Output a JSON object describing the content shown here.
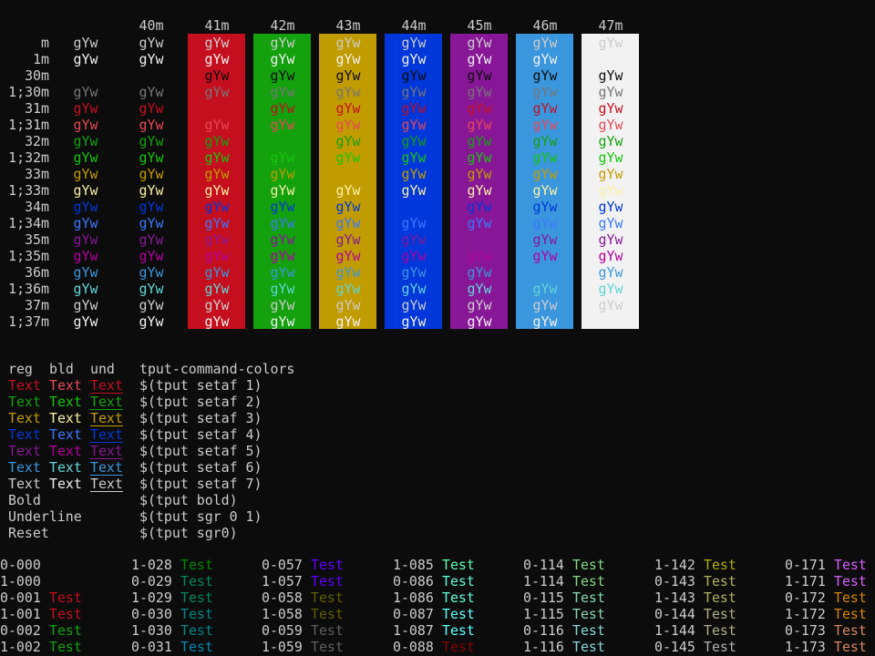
{
  "terminal": {
    "background": "#0C0C0C",
    "foreground": "#CCCCCC"
  },
  "color_table": {
    "sample_text": "gYw",
    "columns": [
      {
        "label": "",
        "bg": null
      },
      {
        "label": "40m",
        "bg": null
      },
      {
        "label": "41m",
        "bg": "#C50F1F"
      },
      {
        "label": "42m",
        "bg": "#13A10E"
      },
      {
        "label": "43m",
        "bg": "#C19C00"
      },
      {
        "label": "44m",
        "bg": "#0037DA"
      },
      {
        "label": "45m",
        "bg": "#881798"
      },
      {
        "label": "46m",
        "bg": "#3A96DD"
      },
      {
        "label": "47m",
        "bg": "#F2F2F2"
      }
    ],
    "rows": [
      {
        "label": "m",
        "fg": "#CCCCCC"
      },
      {
        "label": "1m",
        "fg": "#F2F2F2"
      },
      {
        "label": "30m",
        "fg": "#0C0C0C"
      },
      {
        "label": "1;30m",
        "fg": "#767676"
      },
      {
        "label": "31m",
        "fg": "#C50F1F"
      },
      {
        "label": "1;31m",
        "fg": "#E74856"
      },
      {
        "label": "32m",
        "fg": "#13A10E"
      },
      {
        "label": "1;32m",
        "fg": "#16C60C"
      },
      {
        "label": "33m",
        "fg": "#C19C00"
      },
      {
        "label": "1;33m",
        "fg": "#F9F1A5"
      },
      {
        "label": "34m",
        "fg": "#0037DA"
      },
      {
        "label": "1;34m",
        "fg": "#3B78FF"
      },
      {
        "label": "35m",
        "fg": "#881798"
      },
      {
        "label": "1;35m",
        "fg": "#B4009E"
      },
      {
        "label": "36m",
        "fg": "#3A96DD"
      },
      {
        "label": "1;36m",
        "fg": "#61D6D6"
      },
      {
        "label": "37m",
        "fg": "#CCCCCC"
      },
      {
        "label": "1;37m",
        "fg": "#F2F2F2"
      }
    ]
  },
  "tput": {
    "headers": [
      "reg",
      "bld",
      "und",
      "tput-command-colors"
    ],
    "sample_text": "Text",
    "color_rows": [
      {
        "reg": "#C50F1F",
        "bld": "#E74856",
        "cmd": "$(tput setaf 1)"
      },
      {
        "reg": "#13A10E",
        "bld": "#16C60C",
        "cmd": "$(tput setaf 2)"
      },
      {
        "reg": "#C19C00",
        "bld": "#F9F1A5",
        "cmd": "$(tput setaf 3)"
      },
      {
        "reg": "#0037DA",
        "bld": "#3B78FF",
        "cmd": "$(tput setaf 4)"
      },
      {
        "reg": "#881798",
        "bld": "#B4009E",
        "cmd": "$(tput setaf 5)"
      },
      {
        "reg": "#3A96DD",
        "bld": "#61D6D6",
        "cmd": "$(tput setaf 6)"
      },
      {
        "reg": "#CCCCCC",
        "bld": "#F2F2F2",
        "cmd": "$(tput setaf 7)"
      }
    ],
    "attr_rows": [
      {
        "label": "Bold",
        "cmd": "$(tput bold)"
      },
      {
        "label": "Underline",
        "cmd": "$(tput sgr 0 1)"
      },
      {
        "label": "Reset",
        "cmd": "$(tput sgr0)"
      }
    ]
  },
  "palette_256": {
    "sample_text": "Test",
    "columns": [
      [
        {
          "code": "0-000",
          "color": "#0C0C0C"
        },
        {
          "code": "1-000",
          "color": "#0C0C0C"
        },
        {
          "code": "0-001",
          "color": "#C50F1F"
        },
        {
          "code": "1-001",
          "color": "#C50F1F"
        },
        {
          "code": "0-002",
          "color": "#13A10E"
        },
        {
          "code": "1-002",
          "color": "#13A10E"
        }
      ],
      [
        {
          "code": "1-028",
          "color": "#008700"
        },
        {
          "code": "0-029",
          "color": "#00875F"
        },
        {
          "code": "1-029",
          "color": "#00875F"
        },
        {
          "code": "0-030",
          "color": "#008787"
        },
        {
          "code": "1-030",
          "color": "#008787"
        },
        {
          "code": "0-031",
          "color": "#0087AF"
        }
      ],
      [
        {
          "code": "0-057",
          "color": "#5F00FF"
        },
        {
          "code": "1-057",
          "color": "#5F00FF"
        },
        {
          "code": "0-058",
          "color": "#5F5F00"
        },
        {
          "code": "1-058",
          "color": "#5F5F00"
        },
        {
          "code": "0-059",
          "color": "#5F5F5F"
        },
        {
          "code": "1-059",
          "color": "#5F5F5F"
        }
      ],
      [
        {
          "code": "1-085",
          "color": "#5FFFAF"
        },
        {
          "code": "0-086",
          "color": "#5FFFD7"
        },
        {
          "code": "1-086",
          "color": "#5FFFD7"
        },
        {
          "code": "0-087",
          "color": "#5FFFFF"
        },
        {
          "code": "1-087",
          "color": "#5FFFFF"
        },
        {
          "code": "0-088",
          "color": "#870000"
        }
      ],
      [
        {
          "code": "0-114",
          "color": "#87D787"
        },
        {
          "code": "1-114",
          "color": "#87D787"
        },
        {
          "code": "0-115",
          "color": "#87D7AF"
        },
        {
          "code": "1-115",
          "color": "#87D7AF"
        },
        {
          "code": "0-116",
          "color": "#87D7D7"
        },
        {
          "code": "1-116",
          "color": "#87D7D7"
        }
      ],
      [
        {
          "code": "1-142",
          "color": "#AFAF00"
        },
        {
          "code": "0-143",
          "color": "#AFAF5F"
        },
        {
          "code": "1-143",
          "color": "#AFAF5F"
        },
        {
          "code": "0-144",
          "color": "#AFAF87"
        },
        {
          "code": "1-144",
          "color": "#AFAF87"
        },
        {
          "code": "0-145",
          "color": "#AFAFAF"
        }
      ],
      [
        {
          "code": "0-171",
          "color": "#D75FFF"
        },
        {
          "code": "1-171",
          "color": "#D75FFF"
        },
        {
          "code": "0-172",
          "color": "#D78700"
        },
        {
          "code": "1-172",
          "color": "#D78700"
        },
        {
          "code": "0-173",
          "color": "#D7875F"
        },
        {
          "code": "1-173",
          "color": "#D7875F"
        }
      ]
    ]
  }
}
